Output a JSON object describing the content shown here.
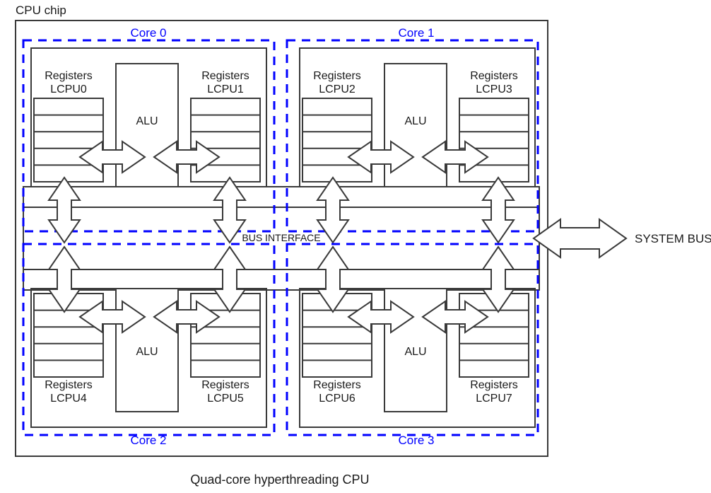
{
  "diagram": {
    "chip_label": "CPU chip",
    "caption": "Quad-core hyperthreading CPU",
    "bus_interface_label": "BUS INTERFACE",
    "system_bus_label": "SYSTEM BUS",
    "alu_label": "ALU",
    "registers_word": "Registers",
    "colors": {
      "core_border": "#0000ff",
      "line": "#3a3a3a",
      "text": "#1a1a1a",
      "background": "#ffffff"
    },
    "cores": [
      {
        "id": "core-0",
        "name": "Core 0",
        "position": "top-left",
        "label_placement": "above",
        "alu": "ALU",
        "register_files": [
          {
            "title": "Registers",
            "subtitle": "LCPU0",
            "side": "left",
            "rows": 5
          },
          {
            "title": "Registers",
            "subtitle": "LCPU1",
            "side": "right",
            "rows": 5
          }
        ]
      },
      {
        "id": "core-1",
        "name": "Core 1",
        "position": "top-right",
        "label_placement": "above",
        "alu": "ALU",
        "register_files": [
          {
            "title": "Registers",
            "subtitle": "LCPU2",
            "side": "left",
            "rows": 5
          },
          {
            "title": "Registers",
            "subtitle": "LCPU3",
            "side": "right",
            "rows": 5
          }
        ]
      },
      {
        "id": "core-2",
        "name": "Core 2",
        "position": "bottom-left",
        "label_placement": "below",
        "alu": "ALU",
        "register_files": [
          {
            "title": "Registers",
            "subtitle": "LCPU4",
            "side": "left",
            "rows": 5
          },
          {
            "title": "Registers",
            "subtitle": "LCPU5",
            "side": "right",
            "rows": 5
          }
        ]
      },
      {
        "id": "core-3",
        "name": "Core 3",
        "position": "bottom-right",
        "label_placement": "below",
        "alu": "ALU",
        "register_files": [
          {
            "title": "Registers",
            "subtitle": "LCPU6",
            "side": "left",
            "rows": 5
          },
          {
            "title": "Registers",
            "subtitle": "LCPU7",
            "side": "right",
            "rows": 5
          }
        ]
      }
    ],
    "logical_cpus": [
      "LCPU0",
      "LCPU1",
      "LCPU2",
      "LCPU3",
      "LCPU4",
      "LCPU5",
      "LCPU6",
      "LCPU7"
    ],
    "core_names": [
      "Core 0",
      "Core 1",
      "Core 2",
      "Core 3"
    ],
    "counts": {
      "cores": 4,
      "logical_cpus_per_core": 2,
      "total_logical_cpus": 8,
      "register_rows_per_file": 5
    }
  }
}
